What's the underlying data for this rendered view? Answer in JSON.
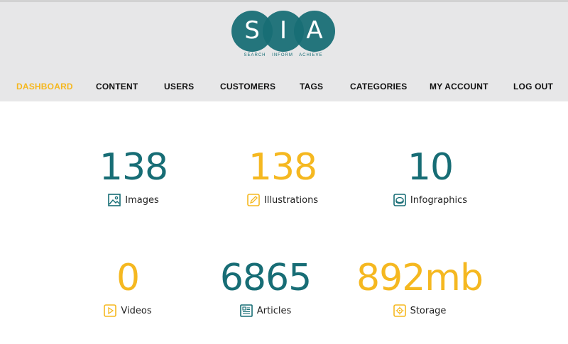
{
  "brand": {
    "letters": [
      "S",
      "I",
      "A"
    ],
    "tagline": "SEARCH INFORM ACHIEVE",
    "color": "#176d75"
  },
  "nav": {
    "items": [
      {
        "label": "DASHBOARD",
        "active": true
      },
      {
        "label": "CONTENT"
      },
      {
        "label": "USERS"
      },
      {
        "label": "CUSTOMERS"
      },
      {
        "label": "TAGS"
      },
      {
        "label": "CATEGORIES"
      },
      {
        "label": "MY ACCOUNT"
      },
      {
        "label": "LOG OUT"
      }
    ],
    "active_color": "#f5b820"
  },
  "stats": [
    {
      "value": "138",
      "label": "Images",
      "icon": "image-icon",
      "color": "#176d75"
    },
    {
      "value": "138",
      "label": "Illustrations",
      "icon": "pencil-icon",
      "color": "#f5b820"
    },
    {
      "value": "10",
      "label": "Infographics",
      "icon": "pie-chart-icon",
      "color": "#176d75"
    },
    {
      "value": "0",
      "label": "Videos",
      "icon": "play-icon",
      "color": "#f5b820"
    },
    {
      "value": "6865",
      "label": "Articles",
      "icon": "article-icon",
      "color": "#176d75"
    },
    {
      "value": "892mb",
      "label": "Storage",
      "icon": "gear-icon",
      "color": "#f5b820"
    }
  ]
}
